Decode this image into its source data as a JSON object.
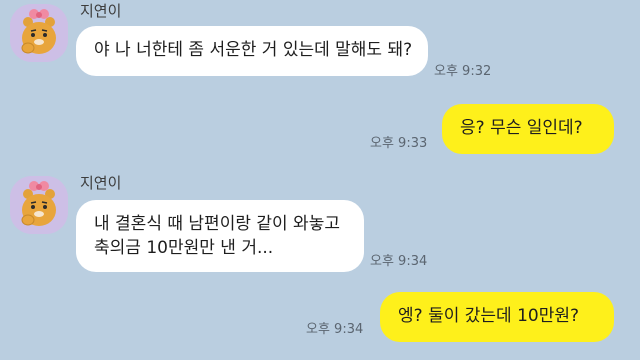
{
  "messages": [
    {
      "sender": "지연이",
      "text": "야 나 너한테 좀 서운한 거 있는데 말해도 돼?",
      "time": "오후 9:32"
    },
    {
      "text": "응? 무슨 일인데?",
      "time": "오후 9:33"
    },
    {
      "sender": "지연이",
      "line1": "내 결혼식 때 남편이랑 같이 와놓고",
      "line2": "축의금 10만원만 낸 거...",
      "time": "오후 9:34"
    },
    {
      "text": "엥? 둘이 갔는데 10만원?",
      "time": "오후 9:34"
    }
  ],
  "avatar_icon": "ryan-character-icon"
}
